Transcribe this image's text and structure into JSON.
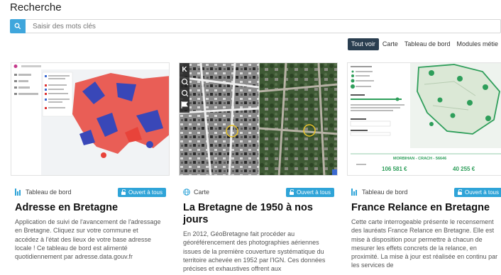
{
  "page": {
    "title": "Recherche"
  },
  "search": {
    "placeholder": "Saisir des mots clés"
  },
  "filters": [
    {
      "label": "Tout voir",
      "active": true
    },
    {
      "label": "Carte"
    },
    {
      "label": "Tableau de bord"
    },
    {
      "label": "Modules métie"
    }
  ],
  "cards": [
    {
      "type": "Tableau de bord",
      "type_icon": "dashboard-icon",
      "badge": "Ouvert à tous",
      "title": "Adresse en Bretagne",
      "description": "Application de suivi de l'avancement de l'adressage en Bretagne. Cliquez sur votre commune et accédez à l'état des lieux de votre base adresse locale ! Ce tableau de bord est alimenté quotidiennement par adresse.data.gouv.fr"
    },
    {
      "type": "Carte",
      "type_icon": "globe-icon",
      "badge": "Ouvert à tous",
      "title": "La Bretagne de 1950 à nos jours",
      "description": "En 2012, GéoBretagne fait procéder au géoréférencement des photographies aériennes issues de la première couverture systématique du territoire achevée en 1952 par l'IGN. Ces données précises et exhaustives offrent aux"
    },
    {
      "type": "Tableau de bord",
      "type_icon": "dashboard-icon",
      "badge": "Ouvert à tous",
      "title": "France Relance en Bretagne",
      "description": "Cette carte interrogeable présente le recensement des lauréats France Relance en Bretagne. Elle est mise à disposition pour permettre à chacun de mesurer les effets concrets de la relance, en proximité. La mise à jour est réalisée en continu par les services de",
      "thumb": {
        "location": "MORBIHAN - CRACH - 56646",
        "amount1": "106 581 €",
        "amount2": "40 255 €"
      }
    }
  ],
  "colors": {
    "accent": "#2fa4d8",
    "active_filter": "#2a3e50",
    "green": "#2e9e5a"
  }
}
